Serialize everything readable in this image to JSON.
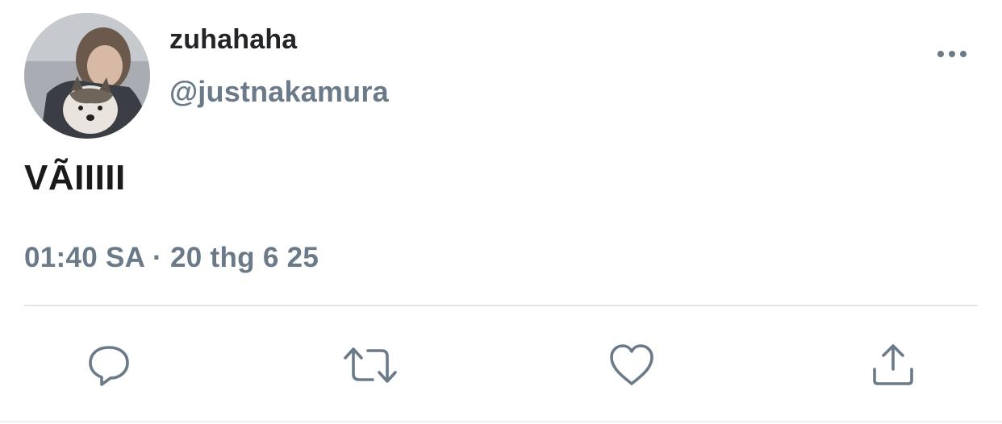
{
  "tweet": {
    "display_name": "zuhahaha",
    "handle": "@justnakamura",
    "text": "VÃIIIII",
    "timestamp": "01:40 SA · 20 thg 6 25"
  },
  "icons": {
    "more": "more-horizontal-icon",
    "reply": "reply-icon",
    "retweet": "retweet-icon",
    "like": "heart-icon",
    "share": "share-icon"
  },
  "colors": {
    "primary_text": "#1a1a1a",
    "secondary_text": "#6b7a88",
    "divider": "#e4e7ea",
    "icon": "#6b7a88"
  }
}
